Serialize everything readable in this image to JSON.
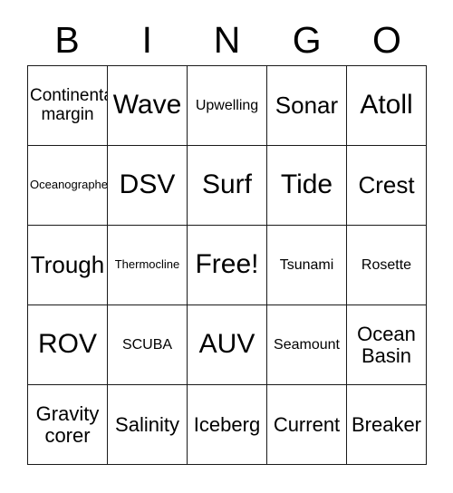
{
  "card": {
    "title": "BINGO",
    "headers": [
      "B",
      "I",
      "N",
      "G",
      "O"
    ],
    "free_space_label": "Free!",
    "colors": {
      "background": "#ffffff",
      "border": "#1a1a1a",
      "text": "#000000"
    },
    "rows": [
      [
        {
          "text": "Continental\nmargin",
          "size": "fs-2l"
        },
        {
          "text": "Wave",
          "size": "fs-xl"
        },
        {
          "text": "Upwelling",
          "size": "fs-sm"
        },
        {
          "text": "Sonar",
          "size": "fs-lg"
        },
        {
          "text": "Atoll",
          "size": "fs-xl"
        }
      ],
      [
        {
          "text": "Oceanographer",
          "size": "fs-xs"
        },
        {
          "text": "DSV",
          "size": "fs-xl"
        },
        {
          "text": "Surf",
          "size": "fs-xl"
        },
        {
          "text": "Tide",
          "size": "fs-xl"
        },
        {
          "text": "Crest",
          "size": "fs-lg"
        }
      ],
      [
        {
          "text": "Trough",
          "size": "fs-lg"
        },
        {
          "text": "Thermocline",
          "size": "fs-xs"
        },
        {
          "text": "Free!",
          "size": "fs-xl"
        },
        {
          "text": "Tsunami",
          "size": "fs-sm"
        },
        {
          "text": "Rosette",
          "size": "fs-sm"
        }
      ],
      [
        {
          "text": "ROV",
          "size": "fs-xl"
        },
        {
          "text": "SCUBA",
          "size": "fs-sm"
        },
        {
          "text": "AUV",
          "size": "fs-xl"
        },
        {
          "text": "Seamount",
          "size": "fs-sm"
        },
        {
          "text": "Ocean\nBasin",
          "size": "fs-2m"
        }
      ],
      [
        {
          "text": "Gravity\ncorer",
          "size": "fs-2m"
        },
        {
          "text": "Salinity",
          "size": "fs-md"
        },
        {
          "text": "Iceberg",
          "size": "fs-md"
        },
        {
          "text": "Current",
          "size": "fs-md"
        },
        {
          "text": "Breaker",
          "size": "fs-md"
        }
      ]
    ]
  }
}
